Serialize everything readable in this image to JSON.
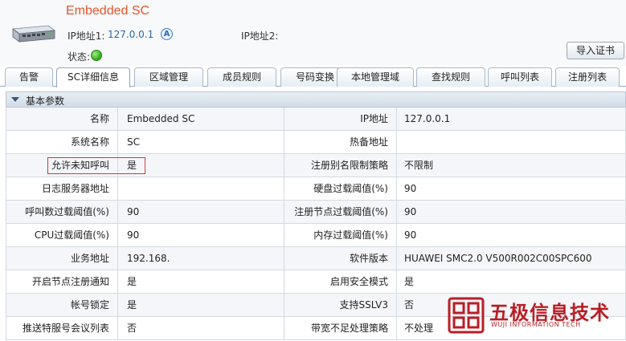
{
  "header": {
    "title": "Embedded SC",
    "ip1_label": "IP地址1:",
    "ip1_value": "127.0.0.1",
    "ip1_badge": "A",
    "ip2_label": "IP地址2:",
    "status_label": "状态:",
    "status_color": "#2aa51a",
    "import_button": "导入证书"
  },
  "tabs": [
    {
      "label": "告警",
      "active": false
    },
    {
      "label": "SC详细信息",
      "active": true
    },
    {
      "label": "区域管理",
      "active": false
    },
    {
      "label": "成员规则",
      "active": false
    },
    {
      "label": "号码变换",
      "active": false
    },
    {
      "label": "本地管理域",
      "active": false
    },
    {
      "label": "查找规则",
      "active": false
    },
    {
      "label": "呼叫列表",
      "active": false
    },
    {
      "label": "注册列表",
      "active": false
    }
  ],
  "section": {
    "title": "基本参数"
  },
  "rows": [
    {
      "l1": "名称",
      "v1": "Embedded SC",
      "l2": "IP地址",
      "v2": "127.0.0.1"
    },
    {
      "l1": "系统名称",
      "v1": "SC",
      "l2": "热备地址",
      "v2": ""
    },
    {
      "l1": "允许未知呼叫",
      "v1": "是",
      "l2": "注册别名限制策略",
      "v2": "不限制"
    },
    {
      "l1": "日志服务器地址",
      "v1": "",
      "l2": "硬盘过载阈值(%)",
      "v2": "90"
    },
    {
      "l1": "呼叫数过载阈值(%)",
      "v1": "90",
      "l2": "注册节点过载阈值(%)",
      "v2": "90"
    },
    {
      "l1": "CPU过载阈值(%)",
      "v1": "90",
      "l2": "内存过载阈值(%)",
      "v2": "90"
    },
    {
      "l1": "业务地址",
      "v1": "192.168.",
      "l2": "软件版本",
      "v2": "HUAWEI SMC2.0 V500R002C00SPC600"
    },
    {
      "l1": "开启节点注册通知",
      "v1": "是",
      "l2": "启用安全模式",
      "v2": "是"
    },
    {
      "l1": "帐号锁定",
      "v1": "是",
      "l2": "支持SSLV3",
      "v2": "否"
    },
    {
      "l1": "推送特服号会议列表",
      "v1": "否",
      "l2": "带宽不足处理策略",
      "v2": "不处理"
    }
  ],
  "watermark": {
    "text": "五极信息技术",
    "subtext": "WUJI INFORMATION TECH",
    "color": "#b91e25"
  },
  "colors": {
    "title": "#e8542a",
    "link": "#2a6aa8",
    "highlight_border": "#d23a3a"
  }
}
